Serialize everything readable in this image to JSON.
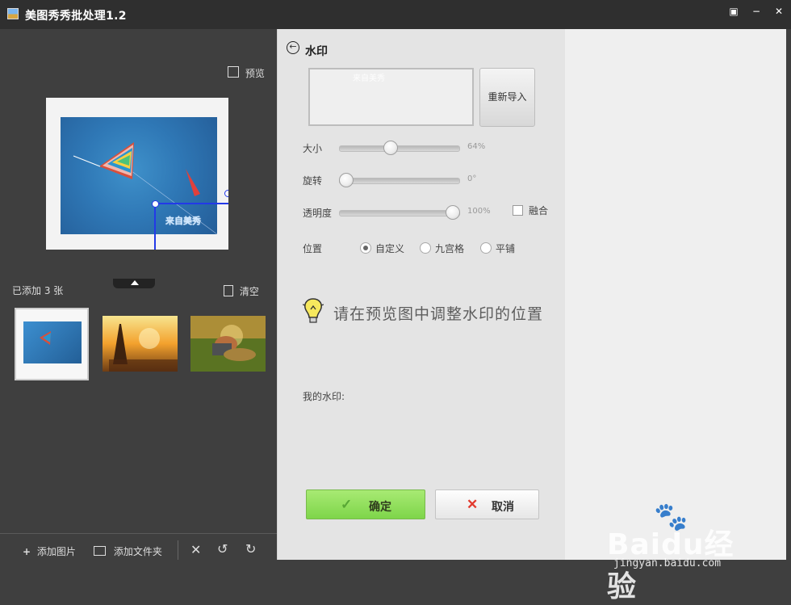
{
  "window": {
    "title": "美图秀秀批处理1.2",
    "controls": [
      "chat-icon",
      "minimize-icon",
      "close-icon"
    ]
  },
  "left_panel": {
    "preview_label": "预览",
    "added_count": "已添加 3 张",
    "clear_label": "清空",
    "watermark_overlay_text": "来自美秀",
    "thumbnails": [
      {
        "name": "kite-photo",
        "selected": true
      },
      {
        "name": "eiffel-photo",
        "selected": false
      },
      {
        "name": "girl-photo",
        "selected": false
      }
    ],
    "bottom_toolbar": {
      "add_image": "添加图片",
      "add_folder": "添加文件夹",
      "icons": [
        "delete-icon",
        "rotate-left-icon",
        "rotate-right-icon"
      ]
    }
  },
  "main_panel": {
    "title": "水印",
    "watermark_preview_text": "来自美秀",
    "reimport_label": "重新导入",
    "settings": {
      "size_label": "大小",
      "size_value": "64%",
      "size_percent": 64,
      "rotation_label": "旋转",
      "rotation_value": "0°",
      "rotation_percent": 0,
      "opacity_label": "透明度",
      "opacity_value": "100%",
      "opacity_percent": 100,
      "blend_label": "融合",
      "blend_checked": false
    },
    "position": {
      "label": "位置",
      "options": [
        {
          "label": "自定义",
          "selected": true
        },
        {
          "label": "九宫格",
          "selected": false
        },
        {
          "label": "平铺",
          "selected": false
        }
      ]
    },
    "hint": "请在预览图中调整水印的位置",
    "my_watermark_label": "我的水印:",
    "buttons": {
      "ok": "确定",
      "cancel": "取消"
    }
  },
  "overlay_watermark": {
    "brand": "Baidu经验",
    "site": "jingyan.baidu.com"
  },
  "colors": {
    "ok_green": "#8fe05b",
    "selection_blue": "#2339e8",
    "panel_bg": "#e4e4e4",
    "dark_bg": "#3f3f3f"
  }
}
